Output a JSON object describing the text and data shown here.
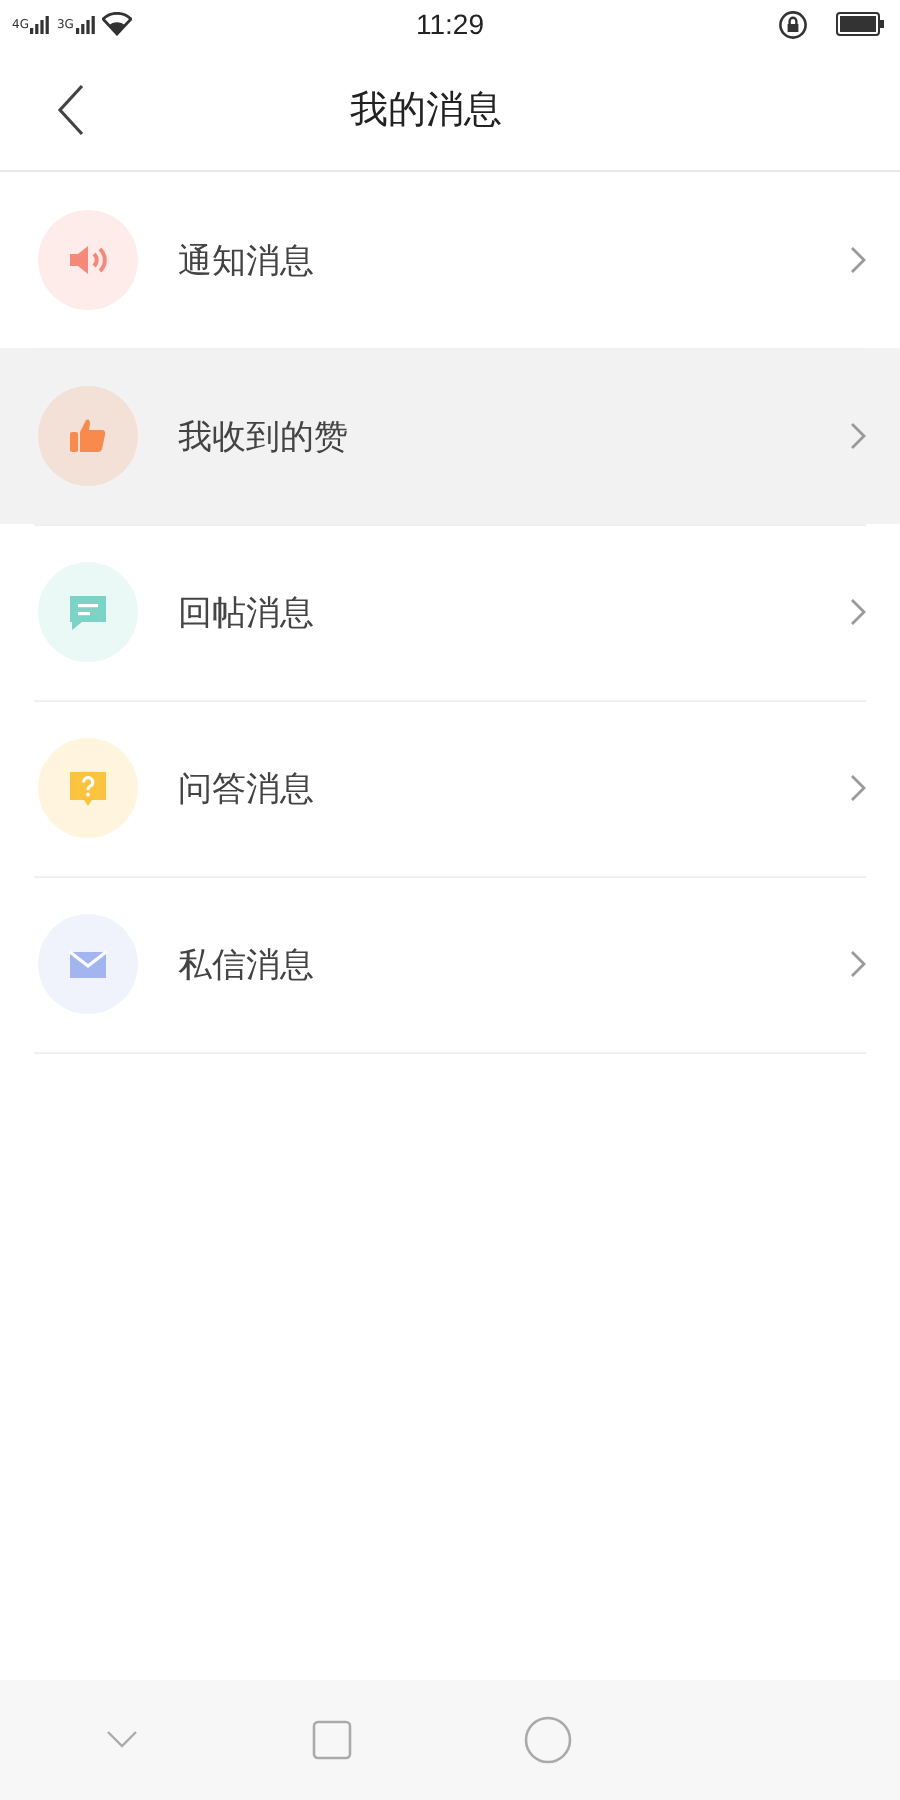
{
  "status_bar": {
    "network_labels": [
      "4G",
      "3G"
    ],
    "time": "11:29"
  },
  "header": {
    "title": "我的消息"
  },
  "items": [
    {
      "kind": "speaker",
      "label": "通知消息",
      "color": "#f4897a",
      "selected": false
    },
    {
      "kind": "thumb",
      "label": "我收到的赞",
      "color": "#f98a4e",
      "selected": true
    },
    {
      "kind": "comment",
      "label": "回帖消息",
      "color": "#7dd3c6",
      "selected": false
    },
    {
      "kind": "question",
      "label": "问答消息",
      "color": "#fcc43e",
      "selected": false
    },
    {
      "kind": "mail",
      "label": "私信消息",
      "color": "#a3b5ef",
      "selected": false
    }
  ]
}
